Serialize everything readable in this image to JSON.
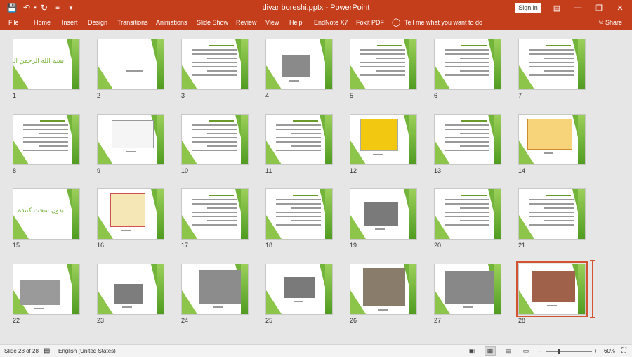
{
  "titlebar": {
    "title": "divar boreshi.pptx  -  PowerPoint",
    "signin": "Sign in",
    "save_icon": "save-icon",
    "undo_icon": "undo-icon",
    "redo_icon": "redo-icon",
    "customize_icon": "quick-access-dropdown-icon"
  },
  "tabs": [
    "File",
    "Home",
    "Insert",
    "Design",
    "Transitions",
    "Animations",
    "Slide Show",
    "Review",
    "View",
    "Help",
    "EndNote X7",
    "Foxit PDF"
  ],
  "tell_me": "Tell me what you want to do",
  "share": "Share",
  "slides": [
    {
      "n": "1",
      "title": "بسم الله الرحمن الرحیم"
    },
    {
      "n": "2"
    },
    {
      "n": "3"
    },
    {
      "n": "4"
    },
    {
      "n": "5"
    },
    {
      "n": "6"
    },
    {
      "n": "7"
    },
    {
      "n": "8"
    },
    {
      "n": "9"
    },
    {
      "n": "10"
    },
    {
      "n": "11"
    },
    {
      "n": "12"
    },
    {
      "n": "13"
    },
    {
      "n": "14"
    },
    {
      "n": "15",
      "title": "بدون سخت کننده"
    },
    {
      "n": "16"
    },
    {
      "n": "17"
    },
    {
      "n": "18"
    },
    {
      "n": "19"
    },
    {
      "n": "20"
    },
    {
      "n": "21"
    },
    {
      "n": "22"
    },
    {
      "n": "23"
    },
    {
      "n": "24"
    },
    {
      "n": "25"
    },
    {
      "n": "26"
    },
    {
      "n": "27"
    },
    {
      "n": "28"
    }
  ],
  "selected_slide": "28",
  "status": {
    "slide_info": "Slide 28 of 28",
    "language": "English (United States)",
    "zoom": "60%",
    "zoom_minus": "–",
    "zoom_plus": "+"
  }
}
